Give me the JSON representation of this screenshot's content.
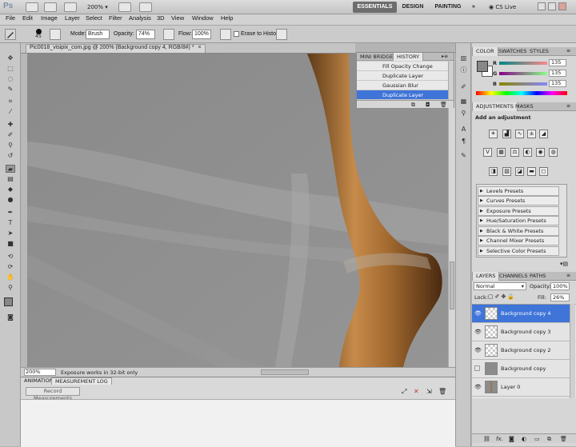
{
  "appbar": {
    "logo": "Ps",
    "zoom": "200%",
    "workspaces": [
      "ESSENTIALS",
      "DESIGN",
      "PAINTING"
    ],
    "more": "»",
    "cslive": "CS Live"
  },
  "menu": [
    "File",
    "Edit",
    "Image",
    "Layer",
    "Select",
    "Filter",
    "Analysis",
    "3D",
    "View",
    "Window",
    "Help"
  ],
  "options": {
    "brush_size": "45",
    "mode_label": "Mode:",
    "mode_value": "Brush",
    "opacity_label": "Opacity:",
    "opacity_value": "74%",
    "flow_label": "Flow:",
    "flow_value": "100%",
    "erase_history": "Erase to History"
  },
  "document": {
    "title": "Pic0018_visipix_com.jpg @ 200% (Background copy 4, RGB/8#) *",
    "close": "×"
  },
  "history": {
    "tabs": [
      "MINI BRIDGE",
      "HISTORY"
    ],
    "items": [
      "Fill Opacity Change",
      "Duplicate Layer",
      "Gaussian Blur",
      "Duplicate Layer"
    ],
    "selected_index": 3
  },
  "status": {
    "zoom": "200%",
    "message": "Exposure works in 32-bit only"
  },
  "bottom": {
    "tabs": [
      "ANIMATION",
      "MEASUREMENT LOG"
    ],
    "record_button": "Record Measurements"
  },
  "color": {
    "tabs": [
      "COLOR",
      "SWATCHES",
      "STYLES"
    ],
    "r_label": "R",
    "g_label": "G",
    "b_label": "B",
    "r": "135",
    "g": "135",
    "b": "135",
    "foreground": "#878787",
    "background_swatch": "#ffffff"
  },
  "adjustments": {
    "tabs": [
      "ADJUSTMENTS",
      "MASKS"
    ],
    "heading": "Add an adjustment",
    "presets": [
      "Levels Presets",
      "Curves Presets",
      "Exposure Presets",
      "Hue/Saturation Presets",
      "Black & White Presets",
      "Channel Mixer Presets",
      "Selective Color Presets"
    ]
  },
  "layers": {
    "tabs": [
      "LAYERS",
      "CHANNELS",
      "PATHS"
    ],
    "blend_mode": "Normal",
    "opacity_label": "Opacity:",
    "opacity_value": "100%",
    "lock_label": "Lock:",
    "fill_label": "Fill:",
    "fill_value": "26%",
    "items": [
      "Background copy 4",
      "Background copy 3",
      "Background copy 2",
      "Background copy",
      "Layer 0"
    ],
    "selected_index": 0,
    "footer_icons": [
      "link-icon",
      "fx-icon",
      "mask-icon",
      "adjustment-icon",
      "folder-icon",
      "new-layer-icon",
      "trash-icon"
    ],
    "fx_text": "fx."
  }
}
